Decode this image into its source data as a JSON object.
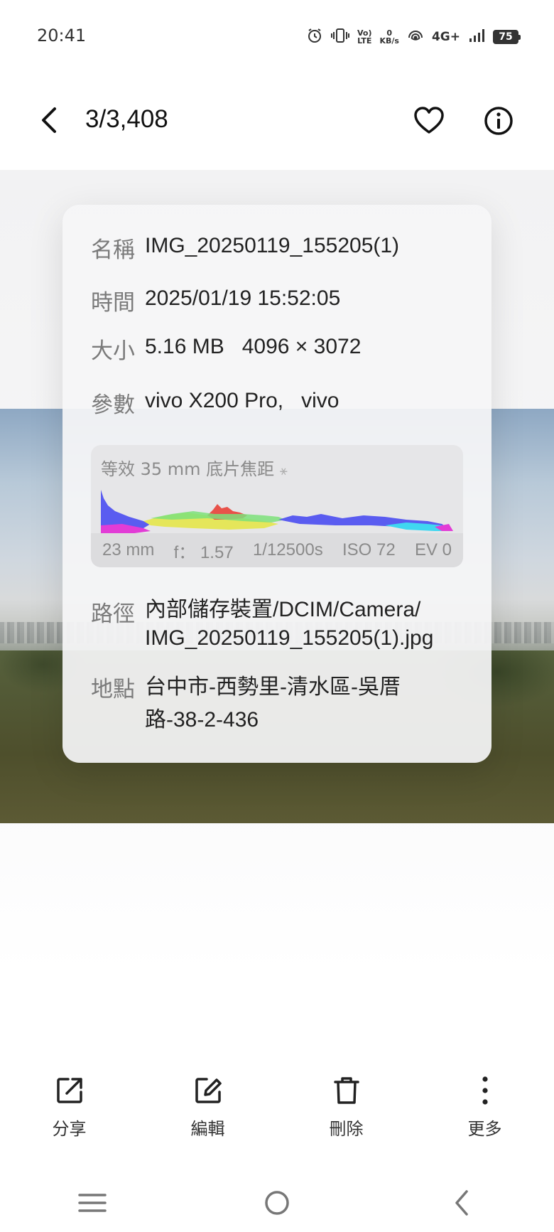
{
  "status_bar": {
    "time": "20:41",
    "network_speed_value": "0",
    "network_speed_unit": "KB/s",
    "volte_top": "Vo)",
    "volte_bottom": "LTE",
    "network_type": "4G+",
    "battery_level": "75"
  },
  "header": {
    "counter": "3/3,408"
  },
  "info": {
    "name_label": "名稱",
    "name_value": "IMG_20250119_155205(1)",
    "time_label": "時間",
    "time_value": "2025/01/19 15:52:05",
    "size_label": "大小",
    "size_value": "5.16 MB   4096 × 3072",
    "params_label": "參數",
    "params_value": "vivo X200 Pro,   vivo",
    "exif": {
      "title": "等效 35 mm 底片焦距",
      "focal_length": "23 mm",
      "aperture": "f： 1.57",
      "shutter": "1/12500s",
      "iso": "ISO 72",
      "ev": "EV 0"
    },
    "path_label": "路徑",
    "path_line1": "內部儲存裝置/DCIM/Camera/",
    "path_line2": "IMG_20250119_155205(1).jpg",
    "location_label": "地點",
    "location_line1": "台中市-西勢里-清水區-吳厝",
    "location_line2": "路-38-2-436"
  },
  "actions": {
    "share": "分享",
    "edit": "編輯",
    "delete": "刪除",
    "more": "更多"
  },
  "colors": {
    "histogram_blue": "#5a5cf0",
    "histogram_red": "#e8524a",
    "histogram_yellow": "#e5e65a",
    "histogram_green": "#7de07a",
    "histogram_cyan": "#3fd7f0",
    "histogram_magenta": "#e23cd6"
  }
}
